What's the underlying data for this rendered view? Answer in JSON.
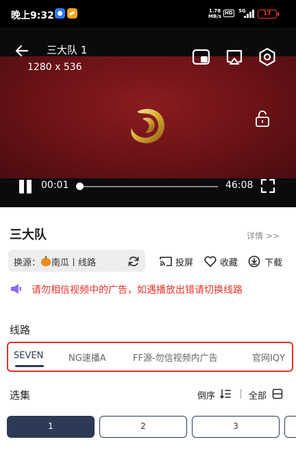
{
  "status_bar": {
    "time": "晚上9:32",
    "net_speed_value": "1.78",
    "net_speed_unit": "MB/s",
    "hd": "HD",
    "network": "5G",
    "battery": "17"
  },
  "player": {
    "title": "三大队 1",
    "resolution": "1280 x 536",
    "current_time": "00:01",
    "duration": "46:08",
    "progress_fraction": 0.0004
  },
  "info": {
    "show_title": "三大队",
    "details_link": "详情 >>",
    "source_prefix": "换源：",
    "source_name": "南瓜",
    "source_sep": "丨",
    "source_route": "线路",
    "actions": {
      "cast": "投屏",
      "favorite": "收藏",
      "download": "下载"
    },
    "notice": "请勿相信视频中的广告，如遇播放出错请切换线路"
  },
  "routes": {
    "section_label": "线路",
    "tabs": [
      "SEVEN",
      "NG速播A",
      "FF源-勿信视频内广告",
      "官网IQY"
    ],
    "active_index": 0
  },
  "episodes": {
    "section_label": "选集",
    "order_label": "倒序",
    "all_label": "全部",
    "items": [
      "1",
      "2",
      "3"
    ],
    "active_index": 0
  },
  "colors": {
    "accent": "#2c3a55",
    "warning": "#e5332a",
    "video_bg": "#6a1217",
    "logo_gold": "#e0b43a"
  }
}
